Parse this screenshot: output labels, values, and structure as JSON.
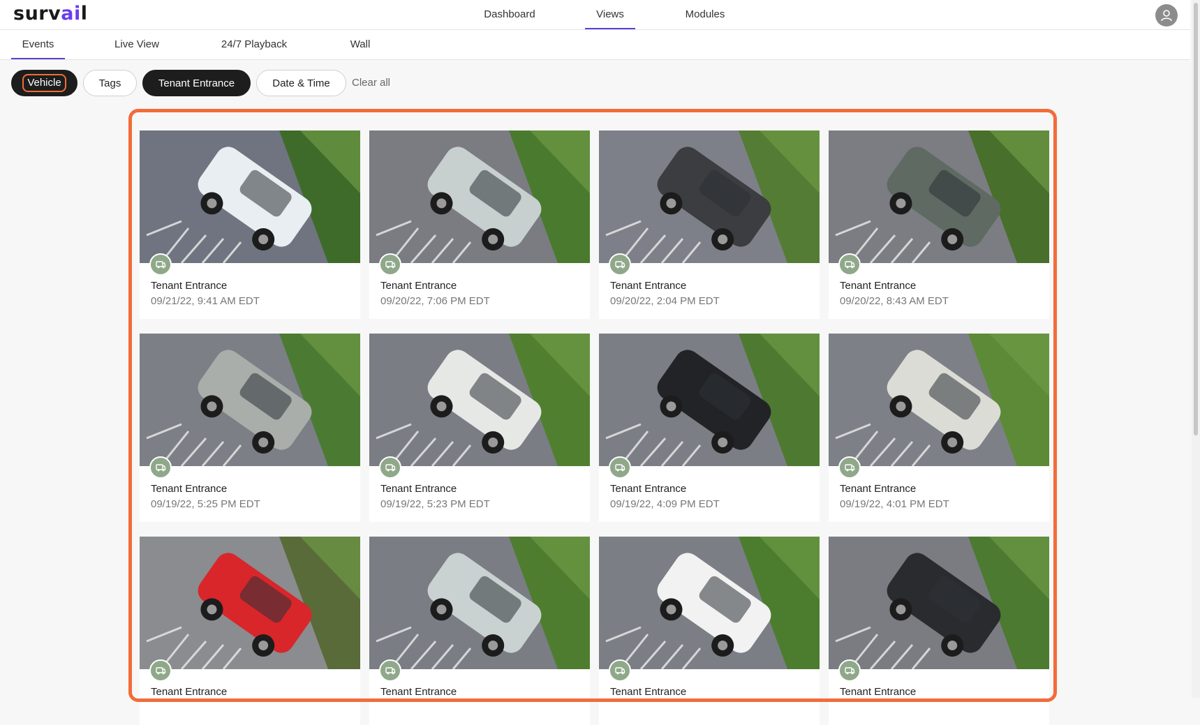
{
  "app": {
    "logo_text_a": "surv",
    "logo_text_b": "ai",
    "logo_text_c": "l"
  },
  "topnav": {
    "items": [
      {
        "label": "Dashboard"
      },
      {
        "label": "Views"
      },
      {
        "label": "Modules"
      }
    ],
    "active": "Views"
  },
  "subtabs": {
    "items": [
      {
        "label": "Events"
      },
      {
        "label": "Live View"
      },
      {
        "label": "24/7 Playback"
      },
      {
        "label": "Wall"
      }
    ],
    "active": "Events"
  },
  "filters": {
    "chips": [
      {
        "label": "Vehicle"
      },
      {
        "label": "Tags"
      },
      {
        "label": "Tenant Entrance"
      },
      {
        "label": "Date & Time"
      }
    ],
    "clear_all": "Clear all"
  },
  "events": [
    {
      "camera": "Tenant Entrance",
      "time": "09/21/22, 9:41 AM EDT",
      "icon": "vehicle-icon"
    },
    {
      "camera": "Tenant Entrance",
      "time": "09/20/22, 7:06 PM EDT",
      "icon": "vehicle-icon"
    },
    {
      "camera": "Tenant Entrance",
      "time": "09/20/22, 2:04 PM EDT",
      "icon": "vehicle-icon"
    },
    {
      "camera": "Tenant Entrance",
      "time": "09/20/22, 8:43 AM EDT",
      "icon": "vehicle-icon"
    },
    {
      "camera": "Tenant Entrance",
      "time": "09/19/22, 5:25 PM EDT",
      "icon": "vehicle-icon"
    },
    {
      "camera": "Tenant Entrance",
      "time": "09/19/22, 5:23 PM EDT",
      "icon": "vehicle-icon"
    },
    {
      "camera": "Tenant Entrance",
      "time": "09/19/22, 4:09 PM EDT",
      "icon": "vehicle-icon"
    },
    {
      "camera": "Tenant Entrance",
      "time": "09/19/22, 4:01 PM EDT",
      "icon": "vehicle-icon"
    },
    {
      "camera": "Tenant Entrance",
      "time": "",
      "icon": "vehicle-icon"
    },
    {
      "camera": "Tenant Entrance",
      "time": "",
      "icon": "vehicle-icon"
    },
    {
      "camera": "Tenant Entrance",
      "time": "",
      "icon": "vehicle-icon"
    },
    {
      "camera": "Tenant Entrance",
      "time": "",
      "icon": "vehicle-icon"
    }
  ],
  "colors": {
    "accent": "#5b3fd6",
    "highlight": "#f26c3a",
    "badge": "#8fa88a"
  }
}
